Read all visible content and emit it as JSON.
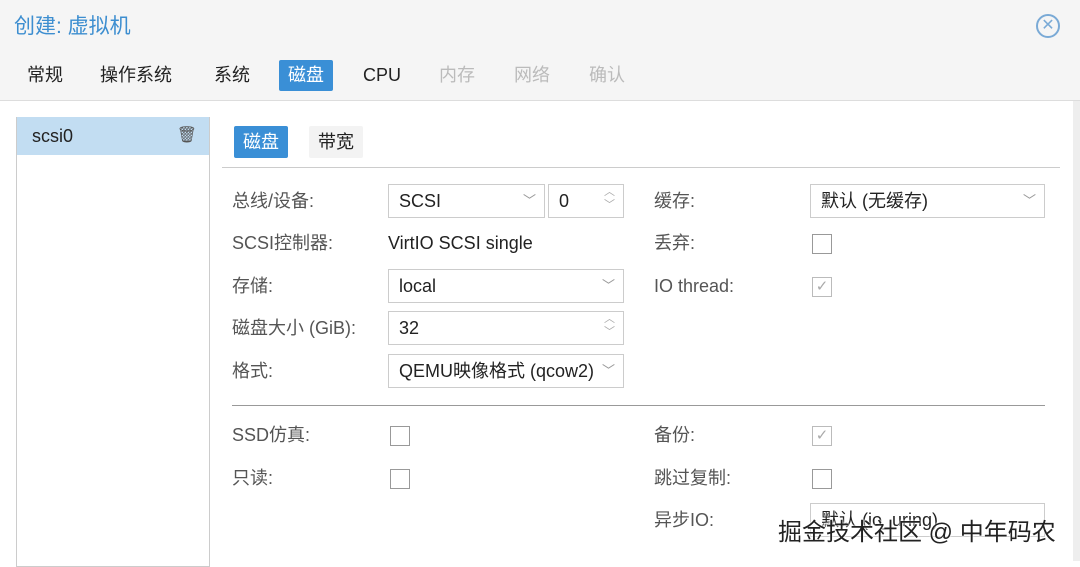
{
  "title": "创建: 虚拟机",
  "tabs": [
    {
      "label": "常规"
    },
    {
      "label": "操作系统"
    },
    {
      "label": "系统"
    },
    {
      "label": "磁盘"
    },
    {
      "label": "CPU"
    },
    {
      "label": "内存"
    },
    {
      "label": "网络"
    },
    {
      "label": "确认"
    }
  ],
  "disk_list": [
    {
      "label": "scsi0"
    }
  ],
  "subtabs": [
    {
      "label": "磁盘"
    },
    {
      "label": "带宽"
    }
  ],
  "form": {
    "bus_label": "总线/设备:",
    "bus_value": "SCSI",
    "bus_index": "0",
    "controller_label": "SCSI控制器:",
    "controller_value": "VirtIO SCSI single",
    "storage_label": "存储:",
    "storage_value": "local",
    "size_label": "磁盘大小 (GiB):",
    "size_value": "32",
    "format_label": "格式:",
    "format_value": "QEMU映像格式 (qcow2)",
    "cache_label": "缓存:",
    "cache_value": "默认 (无缓存)",
    "discard_label": "丢弃:",
    "discard_checked": false,
    "iothread_label": "IO thread:",
    "iothread_checked": true,
    "ssd_label": "SSD仿真:",
    "ssd_checked": false,
    "readonly_label": "只读:",
    "readonly_checked": false,
    "backup_label": "备份:",
    "backup_checked": true,
    "skiprep_label": "跳过复制:",
    "skiprep_checked": false,
    "asyncio_label": "异步IO:",
    "asyncio_value": "默认 (io_uring)"
  },
  "watermark": "掘金技术社区 @ 中年码农",
  "accent": "#3a8fd6"
}
